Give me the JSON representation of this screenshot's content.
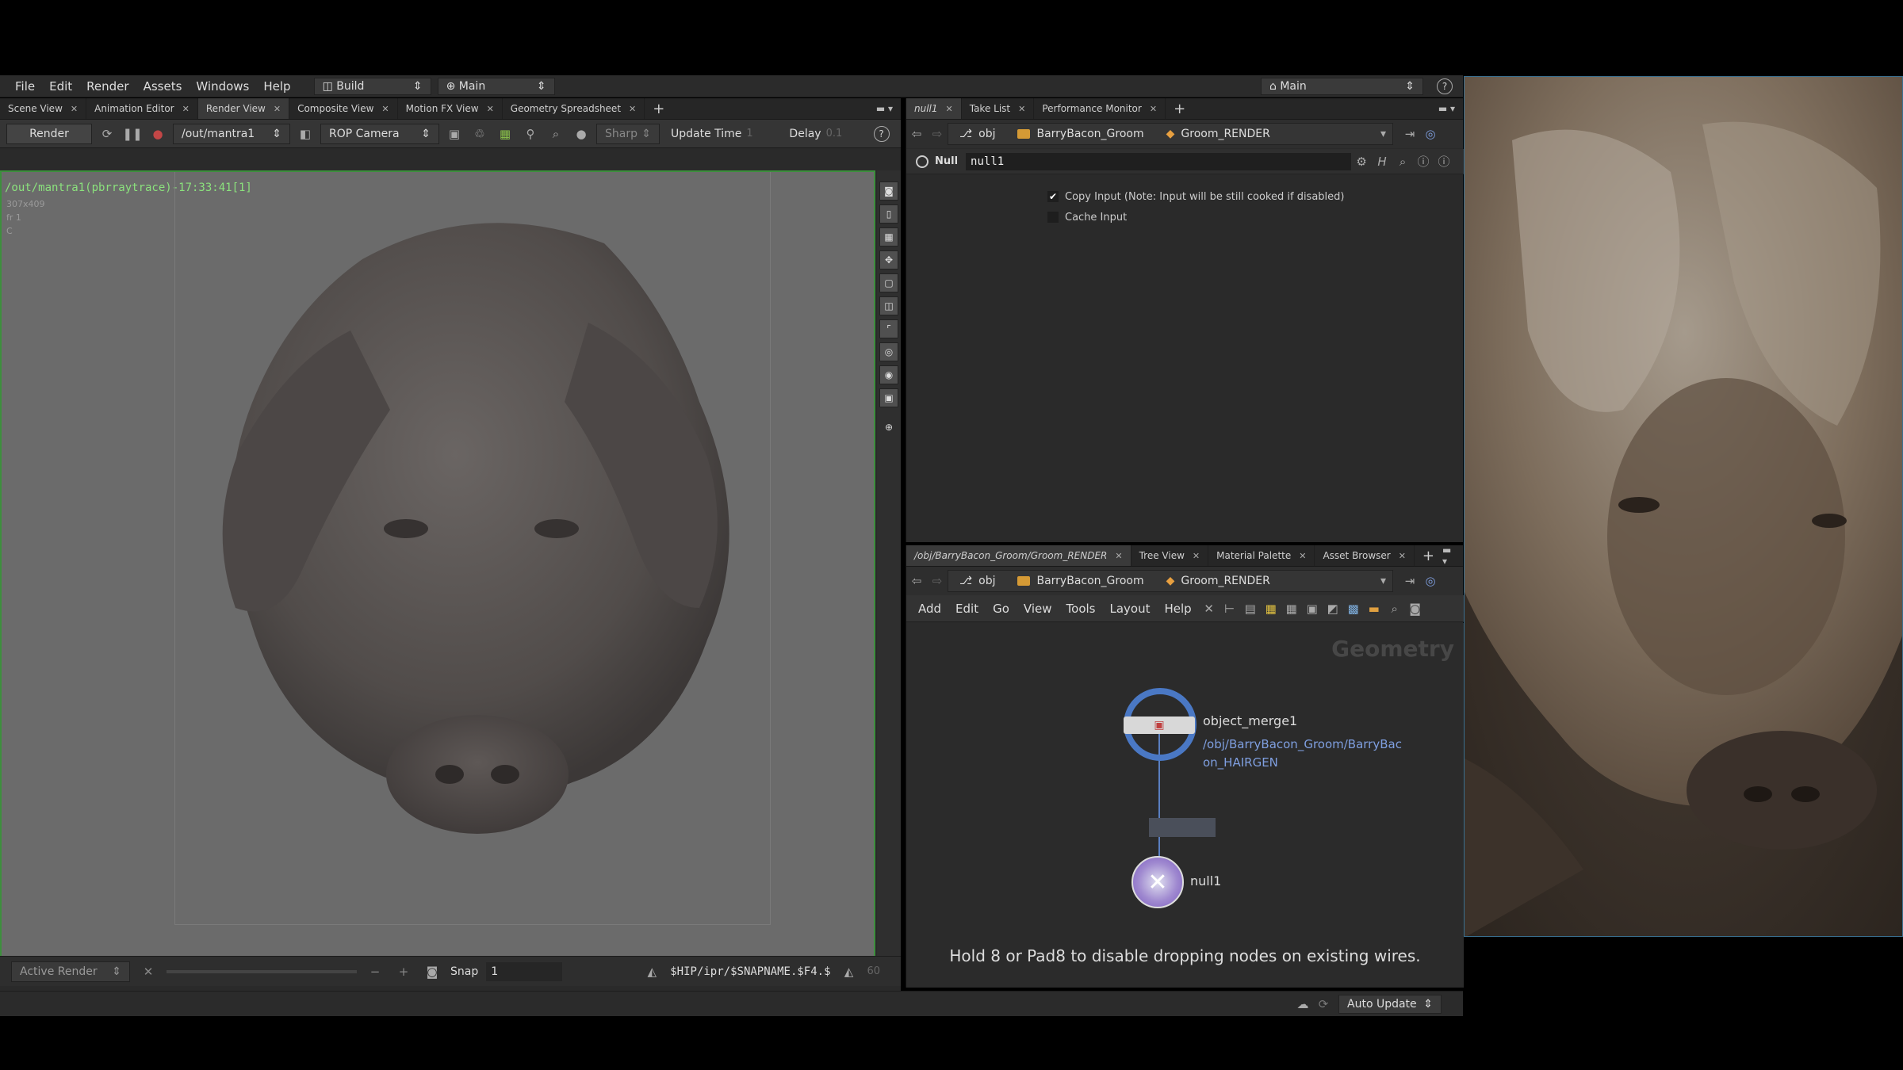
{
  "menubar": {
    "items": [
      "File",
      "Edit",
      "Render",
      "Assets",
      "Windows",
      "Help"
    ],
    "desktop": "Build",
    "context": "Main",
    "right_context": "Main"
  },
  "left_pane": {
    "tabs": [
      "Scene View",
      "Animation Editor",
      "Render View",
      "Composite View",
      "Motion FX View",
      "Geometry Spreadsheet"
    ],
    "active_tab": "Render View",
    "toolbar": {
      "render_button": "Render",
      "rop_path": "/out/mantra1",
      "camera": "ROP Camera",
      "sharp": "Sharp",
      "update_time_label": "Update Time",
      "update_time_value": "1",
      "delay_label": "Delay",
      "delay_value": "0.1"
    },
    "render_info": {
      "title": "/out/mantra1(pbrraytrace)-17:33:41[1]",
      "res": "307x409",
      "frame": "fr 1",
      "channel": "C"
    },
    "status": {
      "active_render": "Active Render",
      "snap_label": "Snap",
      "snap_value": "1",
      "path": "$HIP/ipr/$SNAPNAME.$F4.$",
      "num": "60"
    }
  },
  "param_pane": {
    "tabs": [
      "null1",
      "Take List",
      "Performance Monitor"
    ],
    "path": [
      "obj",
      "BarryBacon_Groom",
      "Groom_RENDER"
    ],
    "node_type": "Null",
    "node_name": "null1",
    "params": [
      {
        "label": "Copy Input (Note: Input will be still cooked if disabled)",
        "checked": true
      },
      {
        "label": "Cache Input",
        "checked": false
      }
    ]
  },
  "network_pane": {
    "tabs": [
      "/obj/BarryBacon_Groom/Groom_RENDER",
      "Tree View",
      "Material Palette",
      "Asset Browser"
    ],
    "path": [
      "obj",
      "BarryBacon_Groom",
      "Groom_RENDER"
    ],
    "menu": [
      "Add",
      "Edit",
      "Go",
      "View",
      "Tools",
      "Layout",
      "Help"
    ],
    "context_label": "Geometry",
    "nodes": [
      {
        "name": "object_merge1",
        "subtitle": "/obj/BarryBacon_Groom/BarryBac\non_HAIRGEN"
      },
      {
        "name": "null1"
      }
    ],
    "hint": "Hold 8 or Pad8 to disable dropping nodes on existing wires."
  },
  "footer": {
    "auto_update": "Auto Update"
  },
  "colors": {
    "accent_green": "#6fc06f",
    "node_blue": "#4a78c4",
    "link_blue": "#7f9fe0"
  }
}
